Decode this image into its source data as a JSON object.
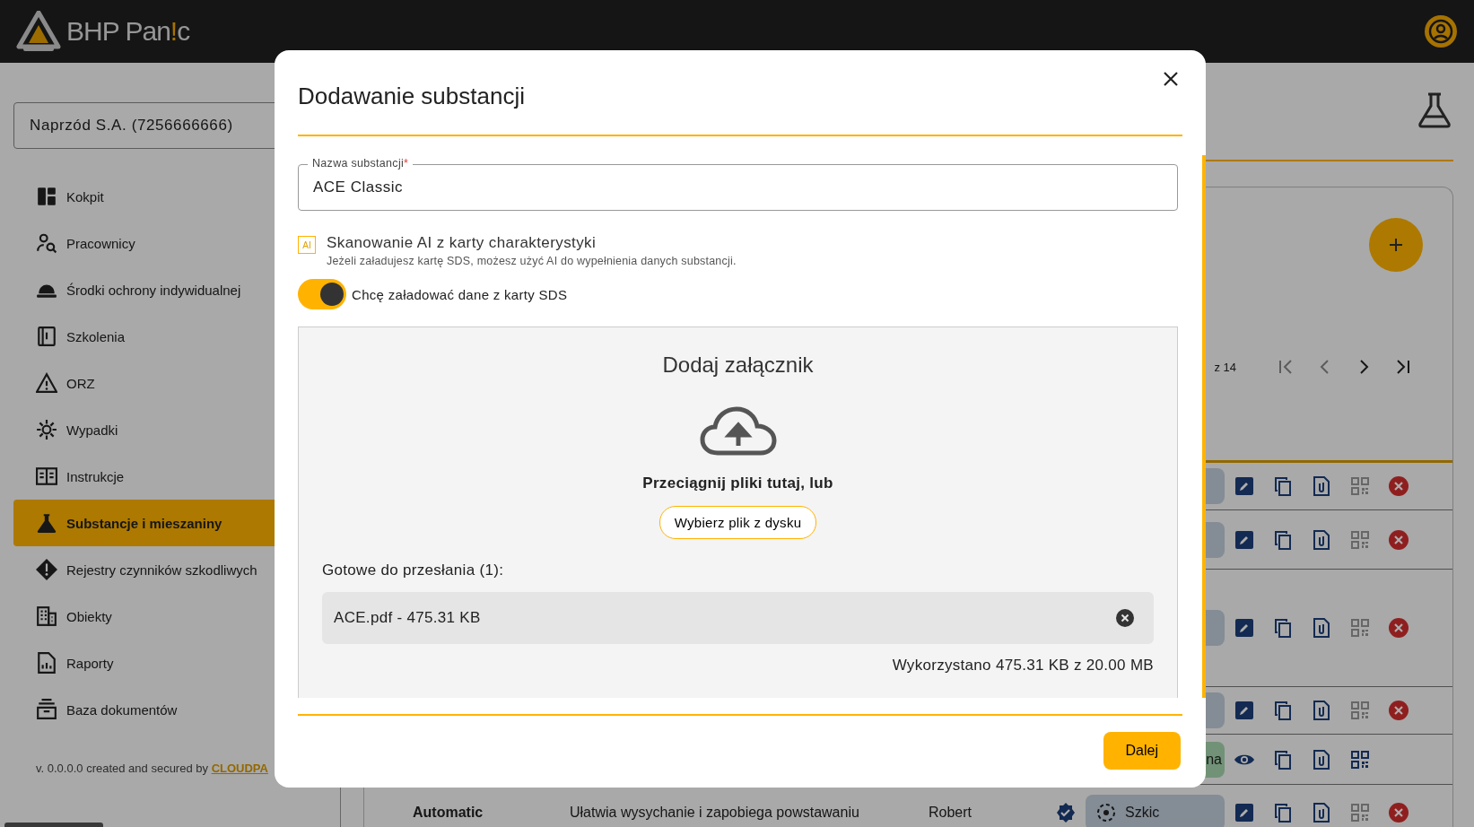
{
  "header": {
    "logo": {
      "before": "BHP Pan",
      "accent": "!",
      "after": "c"
    }
  },
  "sidebar": {
    "company_select": "Naprzód S.A. (7256666666)",
    "items": [
      {
        "label": "Kokpit",
        "selected": false
      },
      {
        "label": "Pracownicy",
        "selected": false
      },
      {
        "label": "Środki ochrony indywidualnej",
        "selected": false
      },
      {
        "label": "Szkolenia",
        "selected": false
      },
      {
        "label": "ORZ",
        "selected": false
      },
      {
        "label": "Wypadki",
        "selected": false
      },
      {
        "label": "Instrukcje",
        "selected": false
      },
      {
        "label": "Substancje i mieszaniny",
        "selected": true
      },
      {
        "label": "Rejestry czynników szkodliwych",
        "selected": false
      },
      {
        "label": "Obiekty",
        "selected": false
      },
      {
        "label": "Raporty",
        "selected": false
      },
      {
        "label": "Baza dokumentów",
        "selected": false
      }
    ],
    "footer": {
      "text": "v. 0.0.0.0 created and secured by",
      "link": "CLOUDPA"
    }
  },
  "main": {
    "pagination": {
      "range": "z 14",
      "buttons": [
        {
          "kind": "first",
          "disabled": true
        },
        {
          "kind": "prev",
          "disabled": true
        },
        {
          "kind": "next",
          "disabled": false
        },
        {
          "kind": "last",
          "disabled": false
        }
      ]
    },
    "rows": [
      {
        "approved": false
      },
      {
        "approved": false
      },
      {
        "approved": false
      },
      {
        "approved": false
      },
      {
        "approved": true,
        "status": "na"
      },
      {
        "approved": false,
        "name": "Automatic",
        "description": "Ułatwia wysychanie i zapobiega powstawaniu",
        "author": "Robert",
        "verified": true,
        "status": "Szkic"
      }
    ]
  },
  "dialog": {
    "title": "Dodawanie substancji",
    "name_field": {
      "label": "Nazwa substancji",
      "required_mark": "*",
      "value": "ACE Classic"
    },
    "ai_scan": {
      "badge": "AI",
      "title": "Skanowanie AI z karty charakterystyki",
      "hint": "Jeżeli załadujesz kartę SDS, możesz użyć AI do wypełnienia danych substancji."
    },
    "sds_toggle": {
      "label": "Chcę załadować dane z karty SDS",
      "on": true
    },
    "upload": {
      "title": "Dodaj załącznik",
      "drop_hint": "Przeciągnij pliki tutaj, lub",
      "browse_button": "Wybierz plik z dysku",
      "ready_label": "Gotowe do przesłania (1):",
      "files": [
        {
          "name": "ACE.pdf - 475.31 KB"
        }
      ],
      "usage": "Wykorzystano 475.31 KB z 20.00 MB"
    },
    "next_button": "Dalej"
  }
}
